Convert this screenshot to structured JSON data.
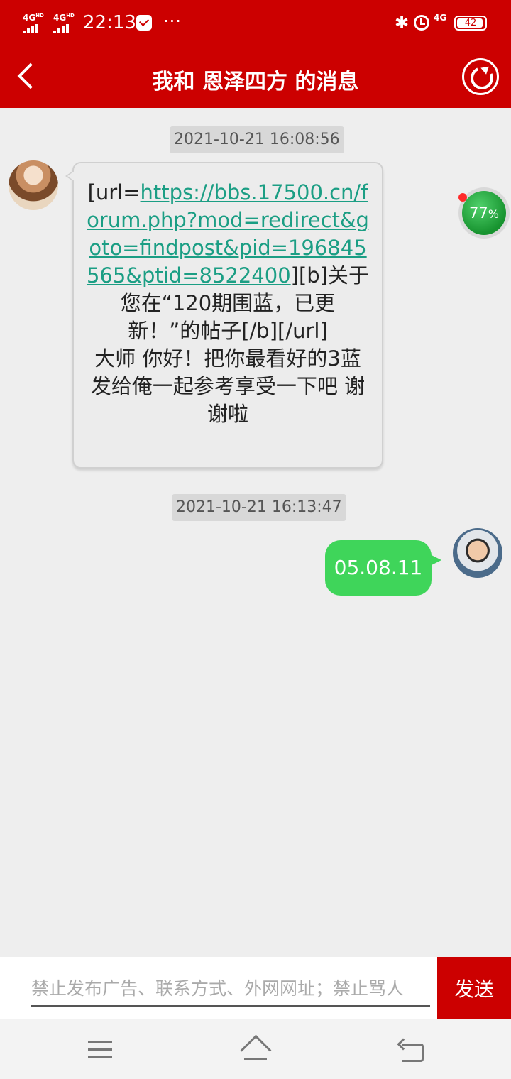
{
  "status_bar": {
    "signal_1": "4G",
    "signal_1_sup": "HD",
    "signal_2": "4G",
    "signal_2_sup": "HD",
    "time": "22:13",
    "dots": "···",
    "network": "4G",
    "battery": "42"
  },
  "header": {
    "title": "我和 恩泽四方 的消息"
  },
  "messages": [
    {
      "timestamp": "2021-10-21 16:08:56",
      "direction": "incoming",
      "text_prefix": "[url=",
      "link": "https://bbs.17500.cn/forum.php?mod=redirect&goto=findpost&pid=196845565&ptid=8522400",
      "text_suffix": "][b]关于您在“120期围蓝，已更新！”的帖子[/b][/url]",
      "body": "大师 你好！把你最看好的3蓝发给俺一起参考享受一下吧 谢谢啦"
    },
    {
      "timestamp": "2021-10-21 16:13:47",
      "direction": "outgoing",
      "body": "05.08.11"
    }
  ],
  "floating_ball": {
    "value": "77",
    "unit": "%"
  },
  "composer": {
    "placeholder": "禁止发布广告、联系方式、外网网址；禁止骂人",
    "value": "",
    "send_label": "发送"
  },
  "colors": {
    "brand": "#cc0000",
    "outgoing_bubble": "#3fd55a",
    "link": "#1b9e84"
  },
  "icons": [
    "back-icon",
    "refresh-icon",
    "bluetooth-icon",
    "alarm-icon",
    "mail-icon",
    "menu-icon",
    "home-icon",
    "back-nav-icon"
  ]
}
